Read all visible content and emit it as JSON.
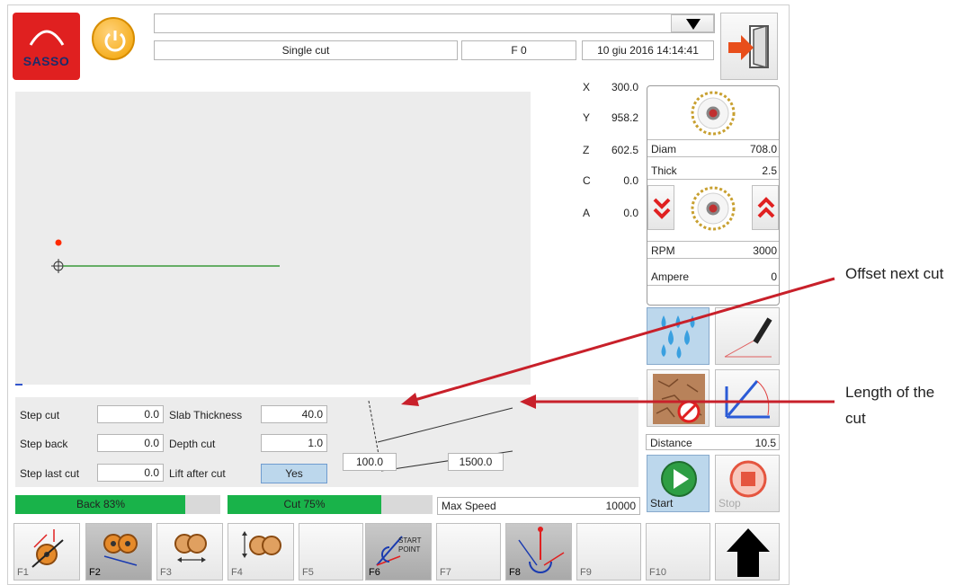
{
  "header": {
    "logo_text": "SASSO",
    "top_dropdown_value": "",
    "mode": "Single cut",
    "feed": "F 0",
    "datetime": "10 giu 2016 14:14:41"
  },
  "axes": [
    {
      "name": "X",
      "value": "300.0"
    },
    {
      "name": "Y",
      "value": "958.2"
    },
    {
      "name": "Z",
      "value": "602.5"
    },
    {
      "name": "C",
      "value": "0.0"
    },
    {
      "name": "A",
      "value": "0.0"
    }
  ],
  "blade": {
    "diam_label": "Diam",
    "diam_value": "708.0",
    "thick_label": "Thick",
    "thick_value": "2.5",
    "rpm_label": "RPM",
    "rpm_value": "3000",
    "ampere_label": "Ampere",
    "ampere_value": "0"
  },
  "distance": {
    "label": "Distance",
    "value": "10.5"
  },
  "params": {
    "step_cut_label": "Step cut",
    "step_cut_value": "0.0",
    "step_back_label": "Step back",
    "step_back_value": "0.0",
    "step_last_cut_label": "Step last cut",
    "step_last_cut_value": "0.0",
    "slab_thickness_label": "Slab Thickness",
    "slab_thickness_value": "40.0",
    "depth_cut_label": "Depth cut",
    "depth_cut_value": "1.0",
    "lift_after_cut_label": "Lift after cut",
    "lift_after_cut_value": "Yes",
    "offset_next_cut_value": "100.0",
    "length_value": "1500.0"
  },
  "progress": {
    "back_label": "Back 83%",
    "back_fraction": 0.83,
    "cut_label": "Cut 75%",
    "cut_fraction": 0.75
  },
  "max_speed": {
    "label": "Max Speed",
    "value": "10000"
  },
  "controls": {
    "start_label": "Start",
    "stop_label": "Stop"
  },
  "fkeys": [
    "F1",
    "F2",
    "F3",
    "F4",
    "F5",
    "F6",
    "F7",
    "F8",
    "F9",
    "F10"
  ],
  "start_point_text": "START POINT",
  "annotations": {
    "offset_next_cut": "Offset next cut",
    "length_of_cut": "Length of the cut"
  },
  "colors": {
    "progress_green": "#19b34a",
    "line_green": "#3a9a3a",
    "start_green": "#2e9e44",
    "stop_red": "#e5553f",
    "arrow_red": "#c8202a",
    "selected_button": "#bcd7ec"
  }
}
